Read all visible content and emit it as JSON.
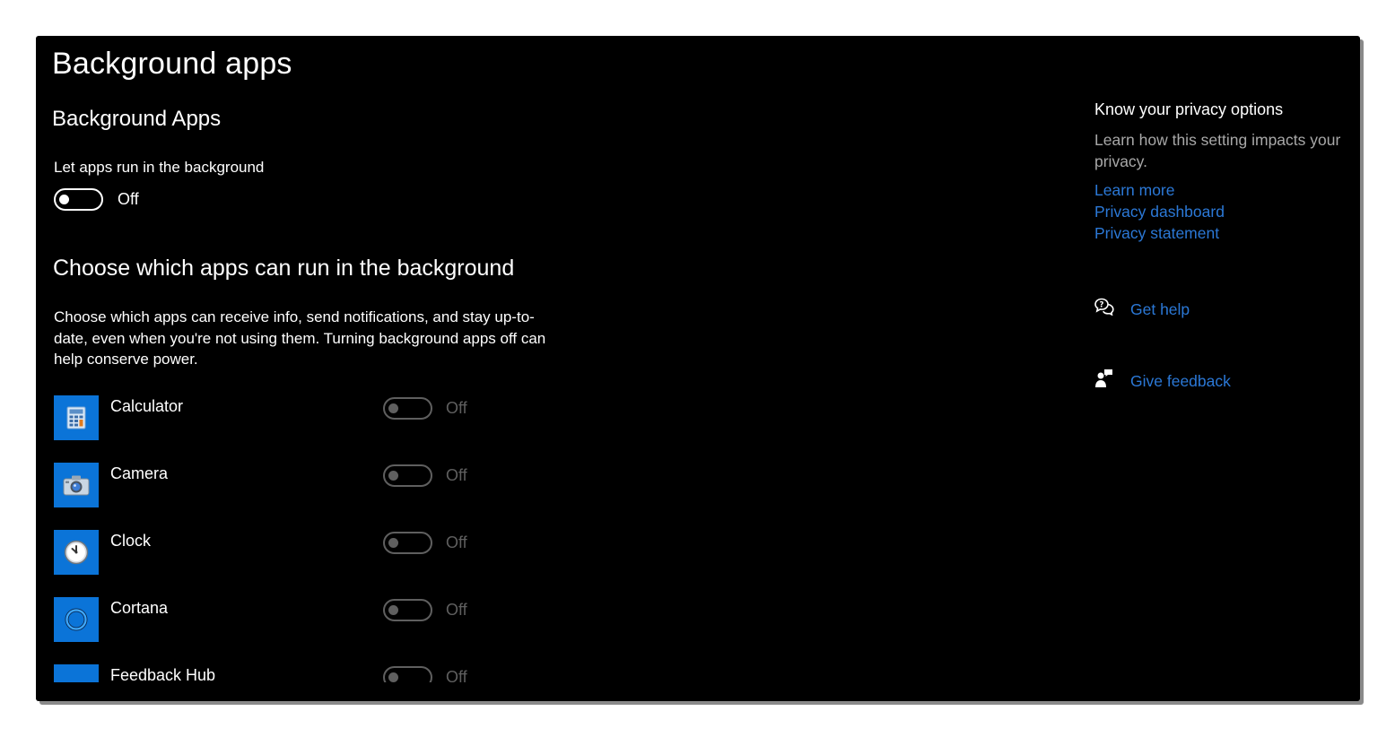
{
  "page": {
    "title": "Background apps",
    "section_title": "Background Apps",
    "main_setting_label": "Let apps run in the background",
    "main_setting_state": "Off",
    "choose_title": "Choose which apps can run in the background",
    "choose_description": "Choose which apps can receive info, send notifications, and stay up-to-date, even when you're not using them. Turning background apps off can help conserve power."
  },
  "apps": [
    {
      "name": "Calculator",
      "state": "Off",
      "icon": "calculator-icon"
    },
    {
      "name": "Camera",
      "state": "Off",
      "icon": "camera-icon"
    },
    {
      "name": "Clock",
      "state": "Off",
      "icon": "clock-icon"
    },
    {
      "name": "Cortana",
      "state": "Off",
      "icon": "cortana-icon"
    },
    {
      "name": "Feedback Hub",
      "state": "Off",
      "icon": "feedback-hub-icon"
    }
  ],
  "sidebar": {
    "title": "Know your privacy options",
    "description": "Learn how this setting impacts your privacy.",
    "links": [
      "Learn more",
      "Privacy dashboard",
      "Privacy statement"
    ],
    "get_help": "Get help",
    "give_feedback": "Give feedback"
  },
  "colors": {
    "background": "#000000",
    "accent": "#2b78d6",
    "app_tile": "#0b74d8",
    "disabled": "#5f5f5f"
  }
}
